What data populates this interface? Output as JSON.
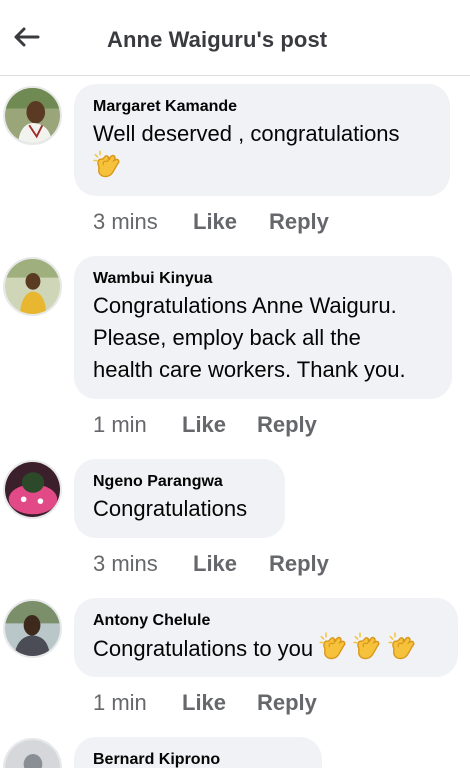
{
  "header": {
    "title": "Anne Waiguru's post",
    "back_icon": "back-arrow-icon"
  },
  "comments": [
    {
      "author": "Margaret Kamande",
      "text": "Well deserved , congratulations",
      "emoji": "clapping-hands",
      "time": "3 mins",
      "like": "Like",
      "reply": "Reply"
    },
    {
      "author": "Wambui Kinyua",
      "text_lines": [
        "Congratulations Anne Waiguru.",
        "Please, employ back all the",
        "health care workers. Thank you."
      ],
      "time": "1 min",
      "like": "Like",
      "reply": "Reply"
    },
    {
      "author": "Ngeno Parangwa",
      "text": "Congratulations",
      "time": "3 mins",
      "like": "Like",
      "reply": "Reply"
    },
    {
      "author": "Antony Chelule",
      "text": "Congratulations to you",
      "emoji": "clapping-hands",
      "time": "1 min",
      "like": "Like",
      "reply": "Reply"
    },
    {
      "author": "Bernard Kiprono"
    }
  ],
  "colors": {
    "bubble": "#f0f2f5",
    "meta_text": "#65676b",
    "header_text": "#3a3b3f"
  }
}
